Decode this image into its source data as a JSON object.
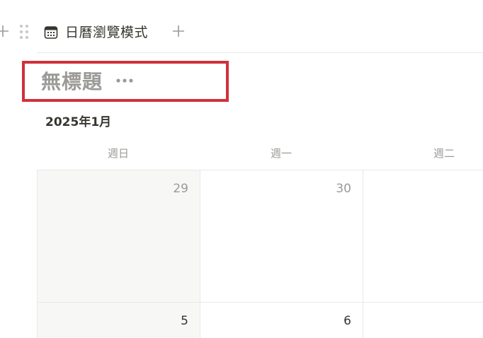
{
  "toolbar": {
    "tab_label": "日曆瀏覽模式"
  },
  "title": {
    "text": "無標題"
  },
  "calendar": {
    "month_label": "2025年1月",
    "weekdays": [
      "週日",
      "週一",
      "週二"
    ],
    "weeks": [
      {
        "days": [
          "29",
          "30",
          ""
        ]
      },
      {
        "days": [
          "5",
          "6",
          ""
        ]
      }
    ]
  },
  "colors": {
    "highlight_box": "#d1303a",
    "muted_text": "#9b9a97",
    "primary_text": "#37352f",
    "weekend_bg": "#f7f7f5",
    "grid_line": "#e9e9e7"
  }
}
